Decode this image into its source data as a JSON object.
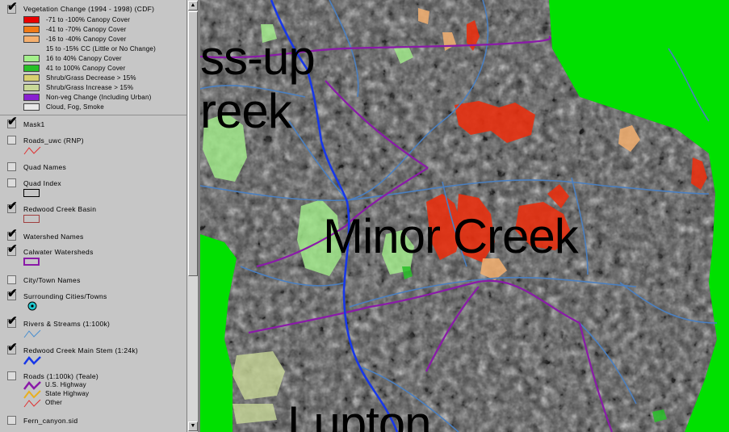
{
  "toc": {
    "legend_items": [
      {
        "label": "-71 to -100% Canopy Cover",
        "color": "#e80000"
      },
      {
        "label": "-41 to -70% Canopy Cover",
        "color": "#f07a18"
      },
      {
        "label": "-16 to -40% Canopy Cover",
        "color": "#f4b070"
      },
      {
        "label": "15 to -15% CC (Little or No Change)",
        "color": ""
      },
      {
        "label": "16 to 40% Canopy Cover",
        "color": "#a4f08c"
      },
      {
        "label": "41 to 100% Canopy Cover",
        "color": "#28c028"
      },
      {
        "label": "Shrub/Grass Decrease > 15%",
        "color": "#d8d070"
      },
      {
        "label": "Shrub/Grass Increase > 15%",
        "color": "#c8d898"
      },
      {
        "label": "Non-veg Change (Including Urban)",
        "color": "#8820d0"
      },
      {
        "label": "Cloud, Fog, Smoke",
        "color": "#e8e8e8"
      }
    ],
    "layers": [
      {
        "name": "Vegetation Change (1994 - 1998) (CDF)",
        "checked": true
      },
      {
        "name": "Mask1",
        "checked": true
      },
      {
        "name": "Roads_uwc (RNP)",
        "checked": false
      },
      {
        "name": "Quad Names",
        "checked": false
      },
      {
        "name": "Quad Index",
        "checked": false
      },
      {
        "name": "Redwood Creek Basin",
        "checked": true
      },
      {
        "name": "Watershed Names",
        "checked": true
      },
      {
        "name": "Calwater Watersheds",
        "checked": true
      },
      {
        "name": "City/Town Names",
        "checked": false
      },
      {
        "name": "Surrounding Cities/Towns",
        "checked": true
      },
      {
        "name": "Rivers & Streams (1:100k)",
        "checked": true
      },
      {
        "name": "Redwood Creek Main Stem (1:24k)",
        "checked": true
      },
      {
        "name": "Roads (1:100k) (Teale)",
        "checked": false
      },
      {
        "name": "Fern_canyon.sid",
        "checked": false
      }
    ],
    "road_classes": [
      "U.S. Highway",
      "State Highway",
      "Other"
    ]
  },
  "scrollbar": {
    "up_icon": "▲",
    "down_icon": "▼"
  },
  "map": {
    "labels": [
      {
        "text": "ss-up"
      },
      {
        "text": "reek"
      },
      {
        "text": "Minor Creek"
      },
      {
        "text": "Lupton"
      }
    ],
    "colors": {
      "mask": "#00e000",
      "stream_main": "#1838e8",
      "streams": "#4a7fc0",
      "watershed_boundary": "#8a1aa8"
    }
  }
}
